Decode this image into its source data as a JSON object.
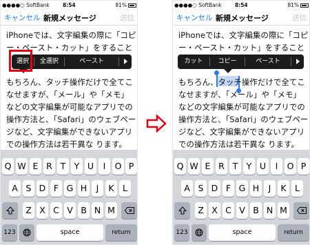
{
  "status_bar": {
    "carrier": "●●●●○ SoftBank",
    "time": "8:54",
    "battery": "81%"
  },
  "nav": {
    "cancel": "キャンセル",
    "title": "新規メッセージ",
    "send": "送信"
  },
  "body_text": {
    "line1": "iPhoneでは、文字編集の際に「コピ",
    "line2": "ー・ペースト・カット」をすること",
    "line4": "もちろん、タッチ操作だけで全てこ",
    "line5": "なせますが、「メール」や「メモ」",
    "line6": "などの文字編集が可能なアプリでの",
    "line7": "操作方法と、「Safari」のウェブペー",
    "line8": "ジなど、文字編集ができないアプリ",
    "line9": "での操作方法は若干異な ります。"
  },
  "left_menu": {
    "items": [
      "選択",
      "全選択",
      "ペースト"
    ]
  },
  "right_menu": {
    "items": [
      "カット",
      "コピー",
      "ペースト"
    ]
  },
  "keyboard": {
    "row1": [
      "Q",
      "W",
      "E",
      "R",
      "T",
      "Y",
      "U",
      "I",
      "O",
      "P"
    ],
    "row2": [
      "A",
      "S",
      "D",
      "F",
      "G",
      "H",
      "J",
      "K",
      "L"
    ],
    "row3": [
      "Z",
      "X",
      "C",
      "V",
      "B",
      "N",
      "M"
    ],
    "numbers": "123",
    "space": "space",
    "return": "return"
  },
  "colors": {
    "accent": "#1a7cf5",
    "highlight_box": "#e60012",
    "arrow": "#e60012"
  },
  "icons": [
    "battery-icon",
    "shift-icon",
    "delete-icon",
    "globe-icon",
    "menu-more-arrow-icon",
    "right-arrow-icon"
  ]
}
